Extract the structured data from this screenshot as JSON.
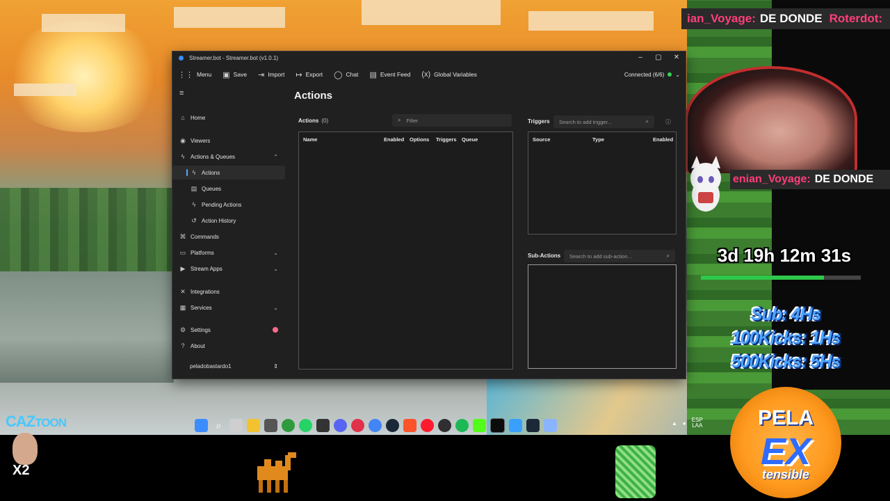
{
  "overlay": {
    "ticker_top": {
      "user": "ian_Voyage:",
      "message": "DE DONDE",
      "user2": "Roterdot:"
    },
    "ticker_mid": {
      "user": "enian_Voyage:",
      "message": "DE DONDE"
    },
    "timer": "3d 19h 12m 31s",
    "timer_progress": 0.77,
    "goals": [
      "Sub: 4Hs",
      "100Kicks: 1Hs",
      "500Kicks: 5Hs"
    ],
    "caz_brand": "CAZ",
    "caz_brand_suffix": "TOON",
    "multiplier": "X2",
    "badge_top": "PELA",
    "badge_mid": "EX",
    "badge_bottom": "tensible",
    "ticker_user_color": "#ff3e7b",
    "timer_bar_color": "#2ec84a"
  },
  "taskbar": {
    "icons": [
      "windows-start-icon",
      "search-icon",
      "task-view-icon",
      "file-explorer-icon",
      "terminal-icon",
      "xbox-icon",
      "whatsapp-icon",
      "app-icon",
      "discord-icon",
      "obs-icon",
      "chrome-icon",
      "steam-icon",
      "brave-icon",
      "opera-icon",
      "obs-studio-icon",
      "spotify-icon",
      "kick-icon",
      "terminal-app-icon",
      "window-icon",
      "steam-app-icon",
      "streamerbot-icon"
    ],
    "lang": "ESP\nLAA"
  },
  "window": {
    "title": "Streamer.bot - Streamer.bot (v1.0.1)",
    "toolbar": {
      "menu": "Menu",
      "save": "Save",
      "import": "Import",
      "export": "Export",
      "chat": "Chat",
      "event_feed": "Event Feed",
      "global_variables": "Global Variables"
    },
    "connection": "Connected (6/6)",
    "connection_color": "#35d353",
    "sidebar": {
      "home": "Home",
      "viewers": "Viewers",
      "actions_queues": "Actions & Queues",
      "actions": "Actions",
      "queues": "Queues",
      "pending_actions": "Pending Actions",
      "action_history": "Action History",
      "commands": "Commands",
      "platforms": "Platforms",
      "stream_apps": "Stream Apps",
      "integrations": "Integrations",
      "services": "Services",
      "settings": "Settings",
      "about": "About",
      "profile": "peladobastardo1"
    },
    "main": {
      "title": "Actions",
      "actions_label": "Actions",
      "actions_count": "(0)",
      "filter_placeholder": "Filter",
      "columns": [
        "Name",
        "Enabled",
        "Options",
        "Triggers",
        "Queue"
      ],
      "triggers_label": "Triggers",
      "triggers_search_placeholder": "Search to add trigger...",
      "trigger_columns": [
        "Source",
        "Type",
        "Enabled"
      ],
      "subactions_label": "Sub-Actions",
      "subactions_search_placeholder": "Search to add sub-action..."
    }
  }
}
